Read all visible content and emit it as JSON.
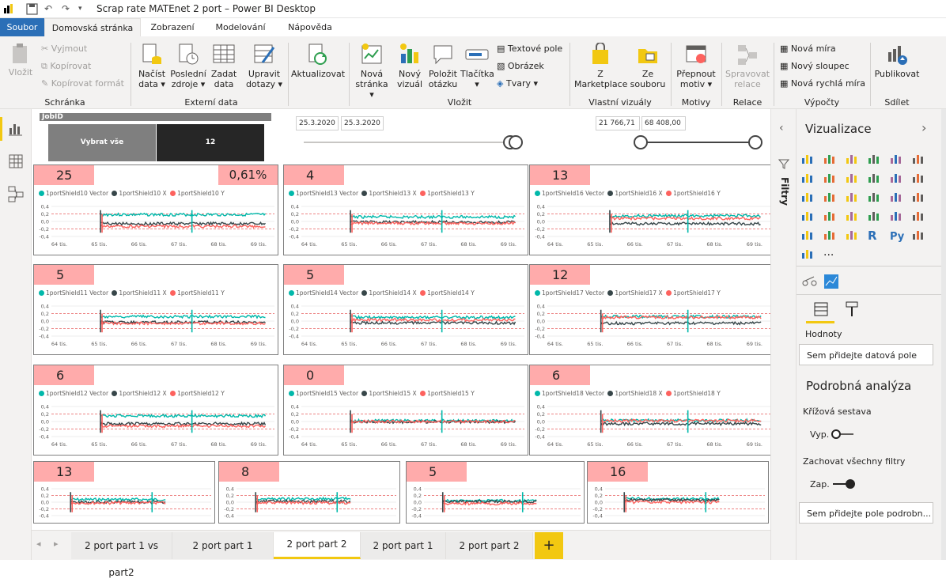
{
  "window": {
    "title": "Scrap rate MATEnet 2 port – Power BI Desktop"
  },
  "tabs": [
    "Soubor",
    "Domovská stránka",
    "Zobrazení",
    "Modelování",
    "Nápověda"
  ],
  "ribbon": {
    "clipboard": {
      "paste": "Vložit",
      "cut": "Vyjmout",
      "copy": "Kopírovat",
      "format": "Kopírovat formát",
      "group": "Schránka"
    },
    "external": {
      "get1": "Načíst",
      "get2": "data",
      "recent1": "Poslední",
      "recent2": "zdroje",
      "enter1": "Zadat",
      "enter2": "data",
      "edit1": "Upravit",
      "edit2": "dotazy",
      "group": "Externí data"
    },
    "refresh": "Aktualizovat",
    "insert": {
      "newpage1": "Nová",
      "newpage2": "stránka",
      "newvisual1": "Nový",
      "newvisual2": "vizuál",
      "ask1": "Položit",
      "ask2": "otázku",
      "buttons": "Tlačítka",
      "textbox": "Textové pole",
      "image": "Obrázek",
      "shapes": "Tvary",
      "group": "Vložit"
    },
    "custom": {
      "mkt1": "Z",
      "mkt2": "Marketplace",
      "file1": "Ze",
      "file2": "souboru",
      "group": "Vlastní vizuály"
    },
    "themes": {
      "switch1": "Přepnout",
      "switch2": "motiv",
      "group": "Motivy"
    },
    "relations": {
      "manage1": "Spravovat",
      "manage2": "relace",
      "group": "Relace"
    },
    "calcs": {
      "measure": "Nová míra",
      "column": "Nový sloupec",
      "quick": "Nová rychlá míra",
      "group": "Výpočty"
    },
    "share": {
      "publish": "Publikovat",
      "group": "Sdílet"
    }
  },
  "slicer": {
    "header": "JobID",
    "select_all": "Vybrat vše",
    "value": "12"
  },
  "date_slicer": {
    "from": "25.3.2020",
    "to": "25.3.2020"
  },
  "range_slicer": {
    "from": "21 766,71",
    "to": "68 408,00"
  },
  "colors": {
    "vector": "#01b8aa",
    "x": "#374649",
    "y": "#fd625e",
    "count_bg": "#ffabab",
    "accent": "#f2c811"
  },
  "panels": [
    {
      "count": "25",
      "pct": "0,61%",
      "legend": [
        "1portShield10 Vector",
        "1portShield10 X",
        "1portShield10 Y"
      ],
      "levels": [
        0.18,
        -0.06,
        -0.13
      ]
    },
    {
      "count": "4",
      "legend": [
        "1portShield13 Vector",
        "1portShield13 X",
        "1portShield13 Y"
      ],
      "levels": [
        0.12,
        -0.02,
        -0.05
      ]
    },
    {
      "count": "13",
      "legend": [
        "1portShield16 Vector",
        "1portShield16 X",
        "1portShield16 Y"
      ],
      "levels": [
        0.15,
        -0.06,
        0.08
      ]
    },
    {
      "count": "5",
      "legend": [
        "1portShield11 Vector",
        "1portShield11 X",
        "1portShield11 Y"
      ],
      "levels": [
        0.12,
        -0.03,
        -0.06
      ]
    },
    {
      "count": "5",
      "legend": [
        "1portShield14 Vector",
        "1portShield14 X",
        "1portShield14 Y"
      ],
      "levels": [
        0.1,
        -0.05,
        0.03
      ]
    },
    {
      "count": "12",
      "legend": [
        "1portShield17 Vector",
        "1portShield17 X",
        "1portShield17 Y"
      ],
      "levels": [
        0.12,
        -0.06,
        0.1
      ]
    },
    {
      "count": "6",
      "legend": [
        "1portShield12 Vector",
        "1portShield12 X",
        "1portShield12 Y"
      ],
      "levels": [
        0.15,
        -0.06,
        -0.12
      ]
    },
    {
      "count": "0",
      "legend": [
        "1portShield15 Vector",
        "1portShield15 X",
        "1portShield15 Y"
      ],
      "levels": [
        0.02,
        -0.01,
        0.0
      ]
    },
    {
      "count": "6",
      "legend": [
        "1portShield18 Vector",
        "1portShield18 X",
        "1portShield18 Y"
      ],
      "levels": [
        0.03,
        -0.06,
        0.02
      ]
    }
  ],
  "small_panels": [
    {
      "count": "13",
      "levels": [
        0.08,
        0.0,
        -0.02
      ]
    },
    {
      "count": "8",
      "levels": [
        0.1,
        0.02,
        -0.02
      ]
    },
    {
      "count": "5",
      "levels": [
        0.04,
        0.02,
        -0.04
      ]
    },
    {
      "count": "16",
      "levels": [
        0.1,
        0.06,
        0.0
      ]
    }
  ],
  "chart": {
    "yticks": [
      "0,4",
      "0,2",
      "0,0",
      "-0,2",
      "-0,4"
    ],
    "xticks": [
      "64 tis.",
      "65 tis.",
      "66 tis.",
      "67 tis.",
      "68 tis.",
      "69 tis."
    ]
  },
  "filters": {
    "label": "Filtry"
  },
  "viz": {
    "title": "Vizualizace",
    "values_label": "Hodnoty",
    "values_well": "Sem přidejte datová pole",
    "drill_title": "Podrobná analýza",
    "cross": "Křížová sestava",
    "cross_state": "Vyp.",
    "keep": "Zachovat všechny filtry",
    "keep_state": "Zap.",
    "drill_well": "Sem přidejte pole podrobn..."
  },
  "pages": [
    "2 port part 1 vs part2",
    "2 port part 1",
    "2 port part 2",
    "2 port part 1",
    "2 port part 2"
  ]
}
